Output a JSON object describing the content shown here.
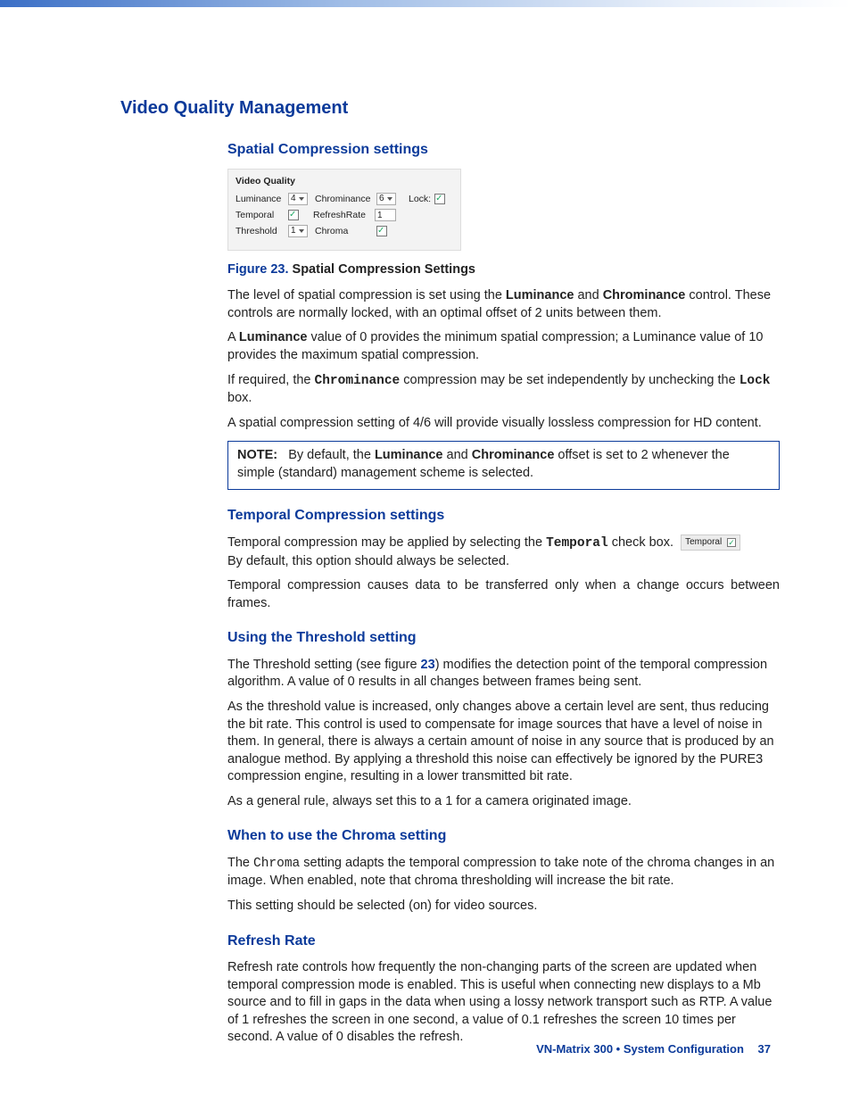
{
  "h1": "Video Quality Management",
  "sections": {
    "spatial": {
      "title": "Spatial Compression settings",
      "panel": {
        "title": "Video Quality",
        "luminance_label": "Luminance",
        "luminance_value": "4",
        "chrominance_label": "Chrominance",
        "chrominance_value": "6",
        "lock_label": "Lock:",
        "lock_checked": true,
        "temporal_label": "Temporal",
        "temporal_checked": true,
        "refreshrate_label": "RefreshRate",
        "refreshrate_value": "1",
        "threshold_label": "Threshold",
        "threshold_value": "1",
        "chroma_label": "Chroma",
        "chroma_checked": true
      },
      "fig_num": "Figure 23.",
      "fig_title": "Spatial Compression Settings",
      "p1_a": "The level of spatial compression is set using the ",
      "p1_b": "Luminance",
      "p1_c": " and ",
      "p1_d": "Chrominance",
      "p1_e": " control. These controls are normally locked, with an optimal offset of 2 units between them.",
      "p2_a": "A ",
      "p2_b": "Luminance",
      "p2_c": " value of 0 provides the minimum spatial compression; a Luminance value of 10 provides the maximum spatial compression.",
      "p3_a": "If required, the ",
      "p3_b": "Chrominance",
      "p3_c": " compression may be set independently by unchecking the ",
      "p3_d": "Lock",
      "p3_e": " box.",
      "p4": "A spatial compression setting of 4/6 will provide visually lossless compression for HD content.",
      "note_label": "NOTE:",
      "note_a": "By default, the ",
      "note_b": "Luminance",
      "note_c": " and ",
      "note_d": "Chrominance",
      "note_e": " offset is set to 2 whenever the simple (standard) management scheme is selected."
    },
    "temporal": {
      "title": "Temporal Compression settings",
      "p1_a": "Temporal compression may be applied by selecting the ",
      "p1_b": "Temporal",
      "p1_c": " check box.",
      "chip_label": "Temporal",
      "p1_d": "By default, this option should always be selected.",
      "p2": "Temporal compression causes data to be transferred only when a change occurs between frames."
    },
    "threshold": {
      "title": "Using the Threshold setting",
      "p1_a": "The Threshold setting (see figure ",
      "p1_b": "23",
      "p1_c": ") modifies the detection point of the temporal compression algorithm. A value of 0 results in all changes between frames being sent.",
      "p2": "As the threshold value is increased, only changes above a certain level are sent, thus reducing the bit rate. This control is used to compensate for image sources that have a level of noise in them. In general, there is always a certain amount of noise in any source that is produced by an analogue method. By applying a threshold this noise can effectively be ignored by the PURE3 compression engine, resulting in a lower transmitted bit rate.",
      "p3": "As a general rule, always set this to a 1 for a camera originated image."
    },
    "chroma": {
      "title": "When to use the Chroma setting",
      "p1_a": "The ",
      "p1_b": "Chroma",
      "p1_c": " setting adapts the temporal compression to take note of the chroma changes in an image. When enabled, note that chroma thresholding will increase the bit rate.",
      "p2": "This setting should be selected (on) for video sources."
    },
    "refresh": {
      "title": "Refresh Rate",
      "p1": "Refresh rate controls how frequently the non-changing parts of the screen are updated when temporal compression mode is enabled. This is useful when connecting new displays to a Mb source and to fill in gaps in the data when using a lossy network transport such as RTP. A value of 1 refreshes the screen in one second, a value of 0.1 refreshes the screen 10 times per second. A value of 0 disables the refresh."
    }
  },
  "footer": {
    "text": "VN-Matrix 300 • System Configuration",
    "page": "37"
  }
}
